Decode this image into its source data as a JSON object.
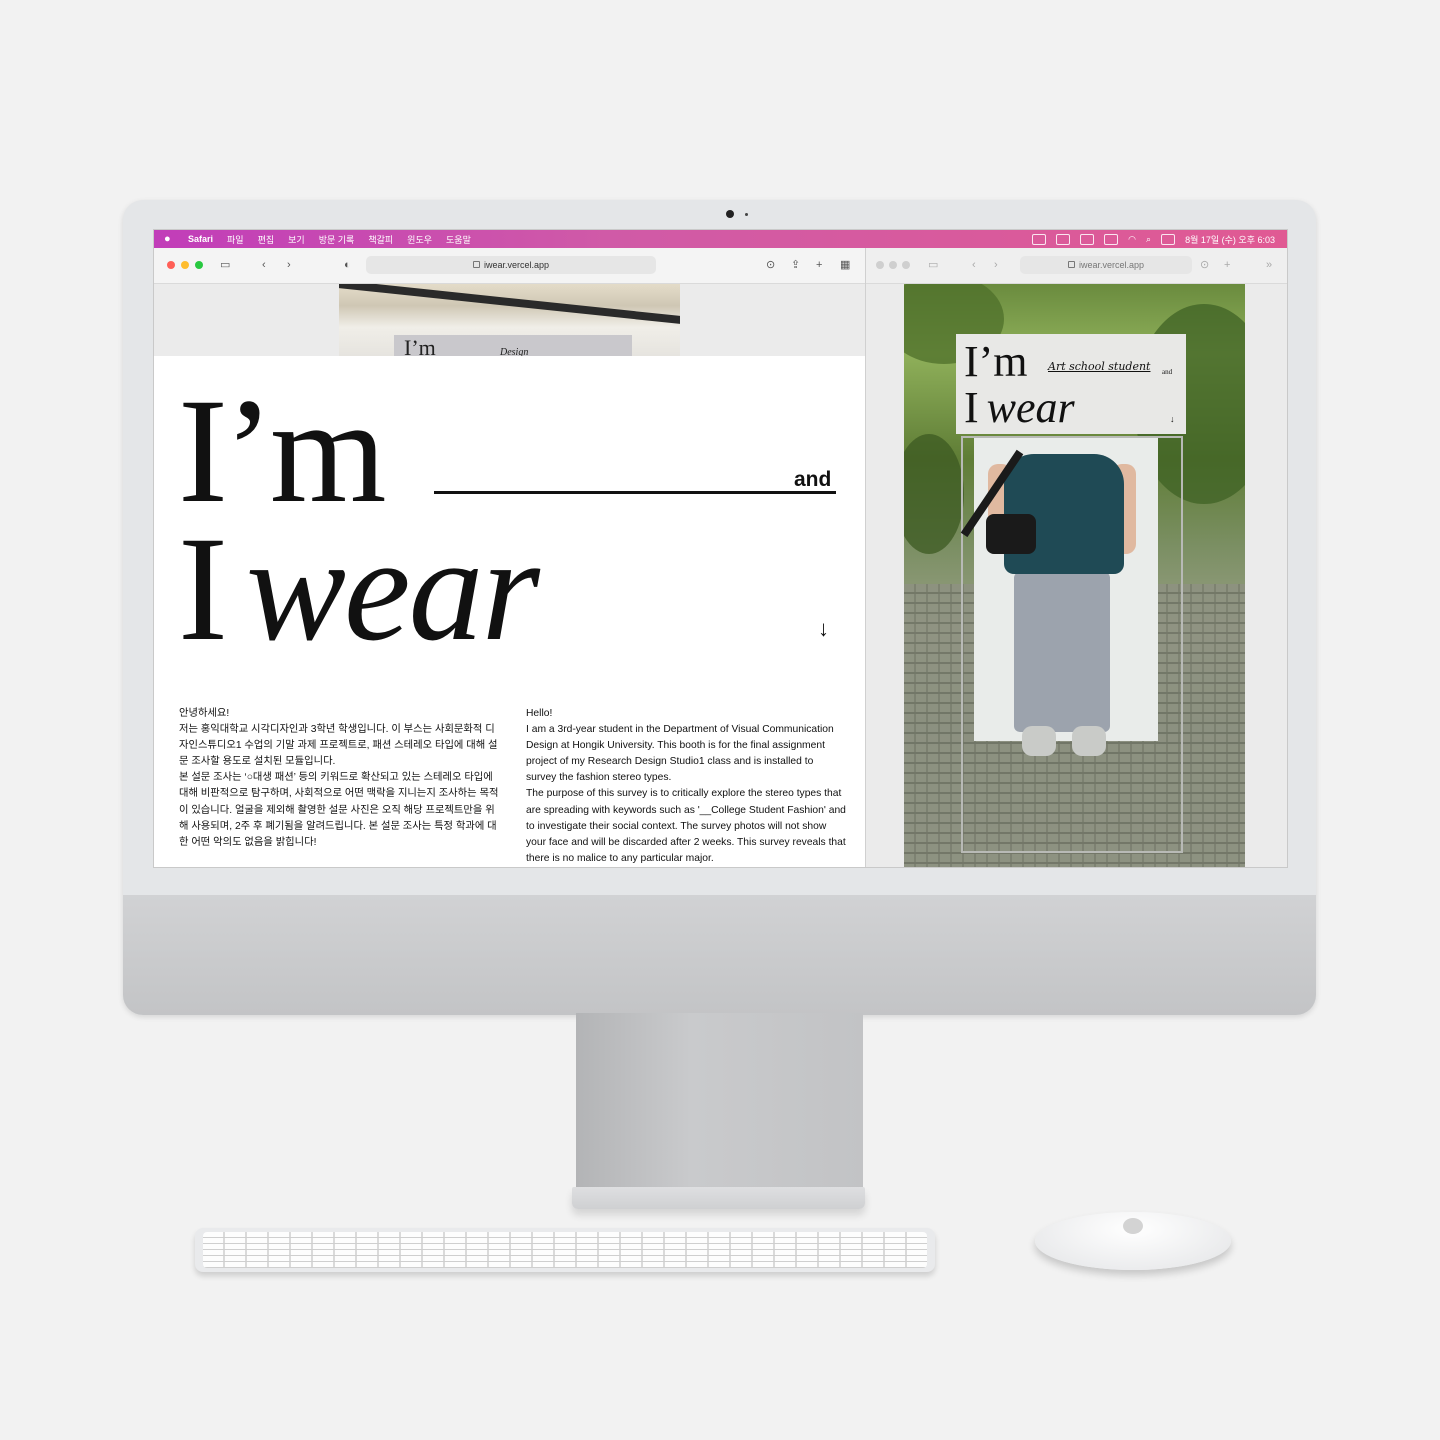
{
  "menubar": {
    "app": "Safari",
    "items": [
      "파일",
      "편집",
      "보기",
      "방문 기록",
      "책갈피",
      "윈도우",
      "도움말"
    ],
    "clock": "8월 17일 (수) 오후 6:03"
  },
  "left_window": {
    "url": "iwear.vercel.app",
    "hero": {
      "line1": "I’m",
      "and": "and",
      "line2_prefix": "I",
      "line2_italic": "wear",
      "arrow": "↓",
      "photo_sign_text": "I’m",
      "photo_sign_small": "Design"
    },
    "korean_text": [
      "안녕하세요!",
      "저는 홍익대학교 시각디자인과 3학년 학생입니다. 이 부스는 사회문화적 디자인스튜디오1 수업의 기말 과제 프로젝트로, 패션 스테레오 타입에 대해 설문 조사할 용도로 설치된 모듈입니다.",
      "본 설문 조사는 ‘○대생 패션’ 등의 키워드로 확산되고 있는 스테레오 타입에 대해 비판적으로 탐구하며, 사회적으로 어떤 맥락을 지니는지 조사하는 목적이 있습니다. 얼굴을 제외해 촬영한 설문 사진은 오직 해당 프로젝트만을 위해 사용되며, 2주 후 폐기됨을 알려드립니다. 본 설문 조사는 특정 학과에 대한 어떤 악의도 없음을 밝힙니다!"
    ],
    "english_text": [
      "Hello!",
      "I am a 3rd-year student in the Department of Visual Communication Design at Hongik University. This booth is for the final assignment project of my Research Design Studio1 class and is installed to survey the fashion stereo types.",
      "The purpose of this survey is to critically explore the stereo types that are spreading with keywords such as '__College Student Fashion' and to investigate their social context. The survey photos will not show your face and will be discarded after 2 weeks. This survey reveals that there is no malice to any particular major."
    ]
  },
  "right_window": {
    "url": "iwear.vercel.app",
    "sign": {
      "line1": "I’m",
      "handwritten": "Art school student",
      "and": "and",
      "line2_prefix": "I",
      "line2_italic": "wear",
      "arrow": "↓"
    }
  },
  "icons": {
    "back": "‹",
    "forward": "›",
    "new_tab": "+",
    "more": "»"
  },
  "colors": {
    "menubar_start": "#c13db9",
    "menubar_end": "#e05a93",
    "close": "#ff5f57",
    "minimize": "#febc2e",
    "zoom": "#28c840"
  }
}
